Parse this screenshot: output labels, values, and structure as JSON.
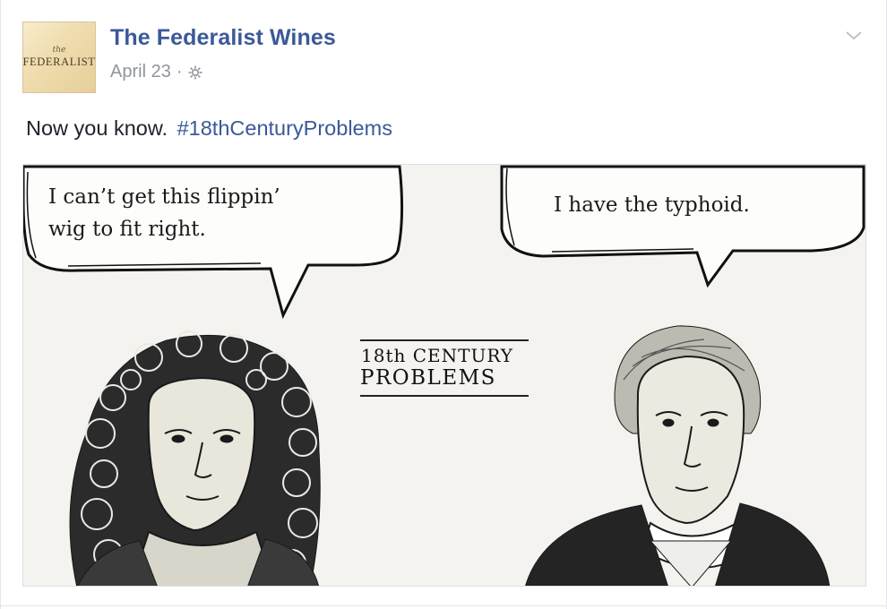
{
  "post": {
    "page_name": "The Federalist Wines",
    "date": "April 23",
    "separator": "·",
    "privacy_icon": "gear-globe-icon",
    "text": "Now you know.",
    "hashtag": "#18thCenturyProblems"
  },
  "avatar": {
    "small_word": "the",
    "brand_word": "FEDERALIST"
  },
  "image": {
    "bubble_left_line1": "I can’t get this flippin’",
    "bubble_left_line2": "wig to fit right.",
    "bubble_right": "I have the typhoid.",
    "title_line1": "18th CENTURY",
    "title_line2": "PROBLEMS"
  },
  "colors": {
    "link": "#3b5998",
    "meta": "#90949c",
    "text": "#1d2129",
    "image_bg": "#f4f3ef"
  }
}
